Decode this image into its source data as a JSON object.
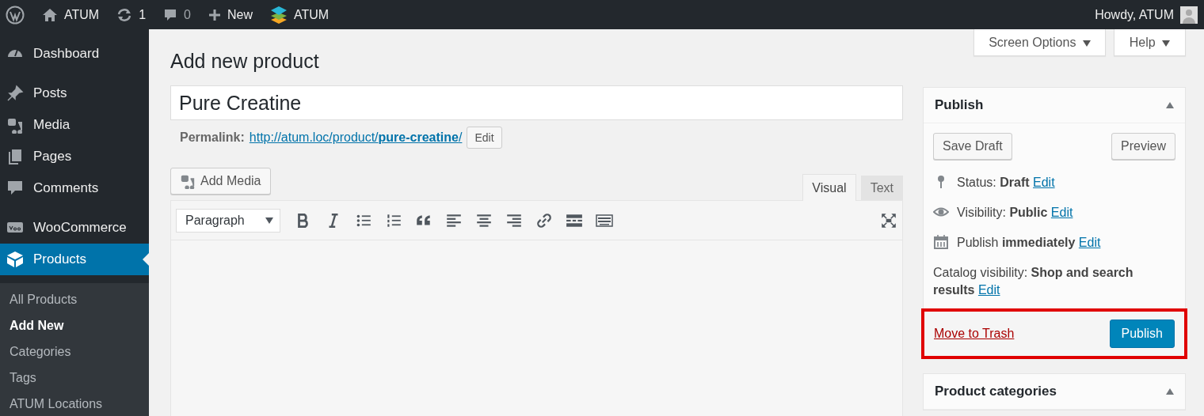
{
  "admin_bar": {
    "site": "ATUM",
    "updates": "1",
    "comments": "0",
    "new": "New",
    "plugin": "ATUM",
    "greeting": "Howdy, ATUM"
  },
  "sidebar": {
    "groups": [
      [
        {
          "label": "Dashboard",
          "selected": false
        }
      ],
      [
        {
          "label": "Posts",
          "selected": false
        },
        {
          "label": "Media",
          "selected": false
        },
        {
          "label": "Pages",
          "selected": false
        },
        {
          "label": "Comments",
          "selected": false
        }
      ],
      [
        {
          "label": "WooCommerce",
          "selected": false
        },
        {
          "label": "Products",
          "selected": true
        }
      ]
    ],
    "submenu": [
      {
        "label": "All Products",
        "selected": false
      },
      {
        "label": "Add New",
        "selected": true
      },
      {
        "label": "Categories",
        "selected": false
      },
      {
        "label": "Tags",
        "selected": false
      },
      {
        "label": "ATUM Locations",
        "selected": false
      }
    ]
  },
  "screen_options": "Screen Options",
  "help": "Help",
  "page_title": "Add new product",
  "product_title": "Pure Creatine",
  "permalink": {
    "label": "Permalink:",
    "url": "http://atum.loc/product/**pure-creatine**/",
    "button": "Edit"
  },
  "add_media": "Add Media",
  "editor_tabs": [
    {
      "label": "Visual",
      "selected": true
    },
    {
      "label": "Text",
      "selected": false
    }
  ],
  "format": "Paragraph",
  "publish_box": {
    "title": "Publish",
    "save_draft": "Save Draft",
    "preview": "Preview",
    "rows": [
      {
        "text": "Status: **Draft**",
        "link": "Edit"
      },
      {
        "text": "Visibility: **Public**",
        "link": "Edit"
      },
      {
        "text": "Publish **immediately**",
        "link": "Edit"
      },
      {
        "text": "Catalog visibility: **Shop and search results**",
        "link": "Edit"
      }
    ],
    "trash": "Move to Trash",
    "publish": "Publish",
    "highlighted": true
  },
  "categories_box": {
    "title": "Product categories"
  }
}
